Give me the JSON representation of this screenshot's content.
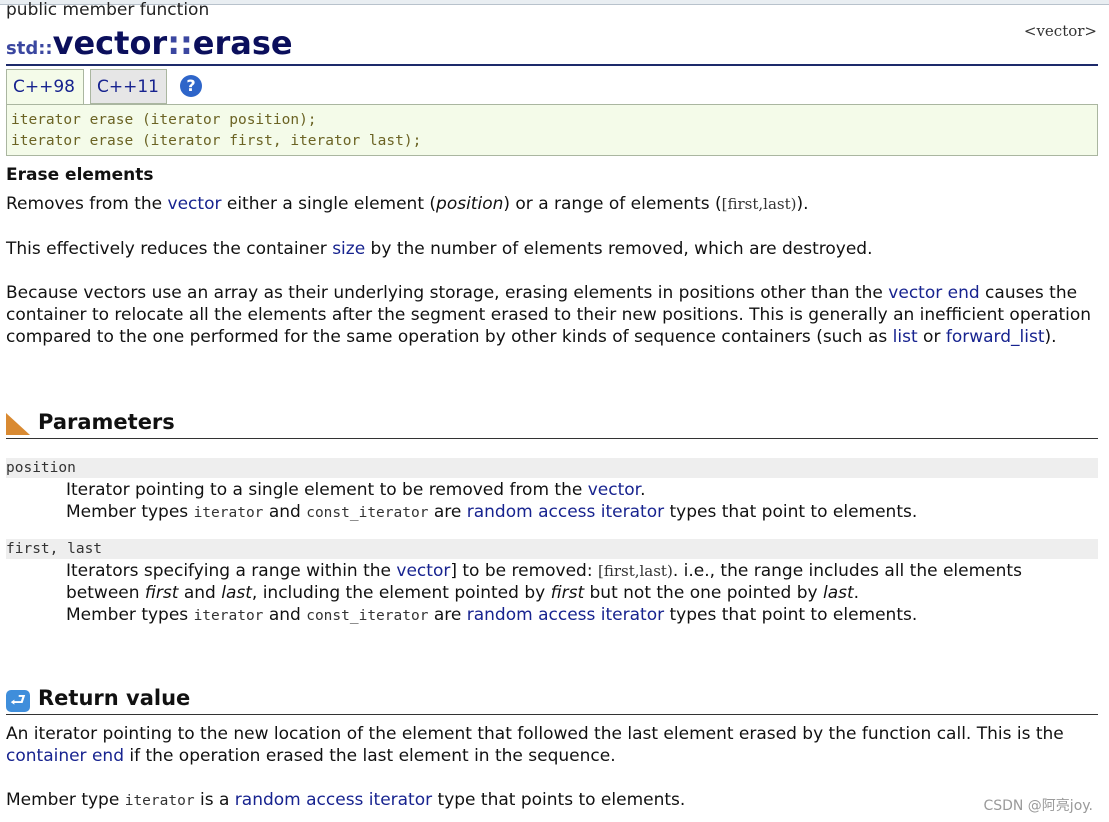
{
  "page": {
    "kind": "public member function",
    "title_ns": "std::",
    "title_name": "vector",
    "title_sep": "::",
    "title_member": "erase",
    "header_tag": "<vector>"
  },
  "tabs": [
    {
      "label": "C++98",
      "active": true
    },
    {
      "label": "C++11",
      "active": false
    }
  ],
  "help_icon": "?",
  "signatures": [
    "iterator erase (iterator position);",
    "iterator erase (iterator first, iterator last);"
  ],
  "description": {
    "heading": "Erase elements",
    "p1": {
      "a": "Removes from the ",
      "link_vector": "vector",
      "b": " either a single element (",
      "position": "position",
      "c": ") or a range of elements (",
      "range": "[first,last)",
      "d": ")."
    },
    "p2": {
      "a": "This effectively reduces the container ",
      "link_size": "size",
      "b": " by the number of elements removed, which are destroyed."
    },
    "p3": {
      "a": "Because vectors use an array as their underlying storage, erasing elements in positions other than the ",
      "link_vector_end": "vector end",
      "b": " causes the container to relocate all the elements after the segment erased to their new positions. This is generally an inefficient operation compared to the one performed for the same operation by other kinds of sequence containers (such as ",
      "link_list": "list",
      "c": " or ",
      "link_forward_list": "forward_list",
      "d": ")."
    }
  },
  "parameters": {
    "heading": "Parameters",
    "icon": "ruler-icon",
    "items": [
      {
        "name": "position",
        "line1_a": "Iterator pointing to a single element to be removed from the ",
        "line1_link": "vector",
        "line1_b": ".",
        "line2_a": "Member types ",
        "type1": "iterator",
        "line2_b": " and ",
        "type2": "const_iterator",
        "line2_c": " are ",
        "line2_link": "random access iterator",
        "line2_d": " types that point to elements."
      },
      {
        "name": "first, last",
        "line1_a": "Iterators specifying a range within the ",
        "line1_link": "vector",
        "line1_b": "] to be removed: ",
        "range": "[first,last)",
        "line1_c": ". i.e., the range includes all the elements between ",
        "first": "first",
        "and": " and ",
        "last": "last",
        "line1_d": ", including the element pointed by ",
        "first2": "first",
        "line1_e": " but not the one pointed by ",
        "last2": "last",
        "line1_f": ".",
        "line2_a": "Member types ",
        "type1": "iterator",
        "line2_b": " and ",
        "type2": "const_iterator",
        "line2_c": " are ",
        "line2_link": "random access iterator",
        "line2_d": " types that point to elements."
      }
    ]
  },
  "return_value": {
    "heading": "Return value",
    "icon": "return-icon",
    "p1_a": "An iterator pointing to the new location of the element that followed the last element erased by the function call. This is the ",
    "p1_link": "container end",
    "p1_b": " if the operation erased the last element in the sequence.",
    "p2_a": "Member type ",
    "p2_type": "iterator",
    "p2_b": " is a ",
    "p2_link": "random access iterator",
    "p2_c": " type that points to elements."
  },
  "watermark": "CSDN @阿亮joy.",
  "colors": {
    "link": "#17238f",
    "title": "#0b0f5c",
    "code_bg": "#f4fbe9",
    "code_text": "#6b6324",
    "param_bg": "#eeeeee"
  }
}
